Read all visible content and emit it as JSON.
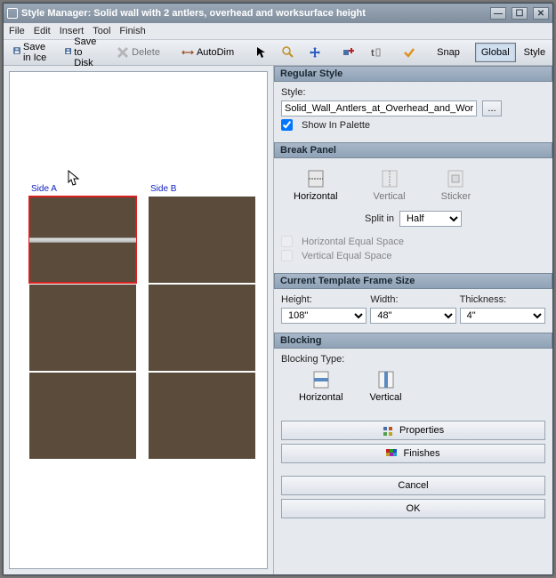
{
  "window": {
    "title": "Style Manager: Solid wall with 2 antlers, overhead and worksurface height"
  },
  "menu": {
    "file": "File",
    "edit": "Edit",
    "insert": "Insert",
    "tool": "Tool",
    "finish": "Finish"
  },
  "toolbar": {
    "save_ice": "Save in Ice",
    "save_disk": "Save to Disk",
    "delete": "Delete",
    "autodim": "AutoDim",
    "snap": "Snap",
    "global": "Global",
    "style": "Style"
  },
  "canvas": {
    "side_a": "Side A",
    "side_b": "Side B"
  },
  "regular_style": {
    "header": "Regular Style",
    "style_label": "Style:",
    "style_value": "Solid_Wall_Antlers_at_Overhead_and_Worksurface_I",
    "show_in_palette": "Show In Palette",
    "show_checked": true
  },
  "break_panel": {
    "header": "Break Panel",
    "horizontal": "Horizontal",
    "vertical": "Vertical",
    "sticker": "Sticker",
    "split_in": "Split in",
    "split_value": "Half",
    "h_equal": "Horizontal Equal Space",
    "v_equal": "Vertical Equal Space"
  },
  "frame_size": {
    "header": "Current Template Frame Size",
    "height_l": "Height:",
    "width_l": "Width:",
    "thick_l": "Thickness:",
    "height_v": "108\"",
    "width_v": "48\"",
    "thick_v": "4\""
  },
  "blocking": {
    "header": "Blocking",
    "type_l": "Blocking Type:",
    "horizontal": "Horizontal",
    "vertical": "Vertical"
  },
  "buttons": {
    "properties": "Properties",
    "finishes": "Finishes",
    "cancel": "Cancel",
    "ok": "OK"
  }
}
